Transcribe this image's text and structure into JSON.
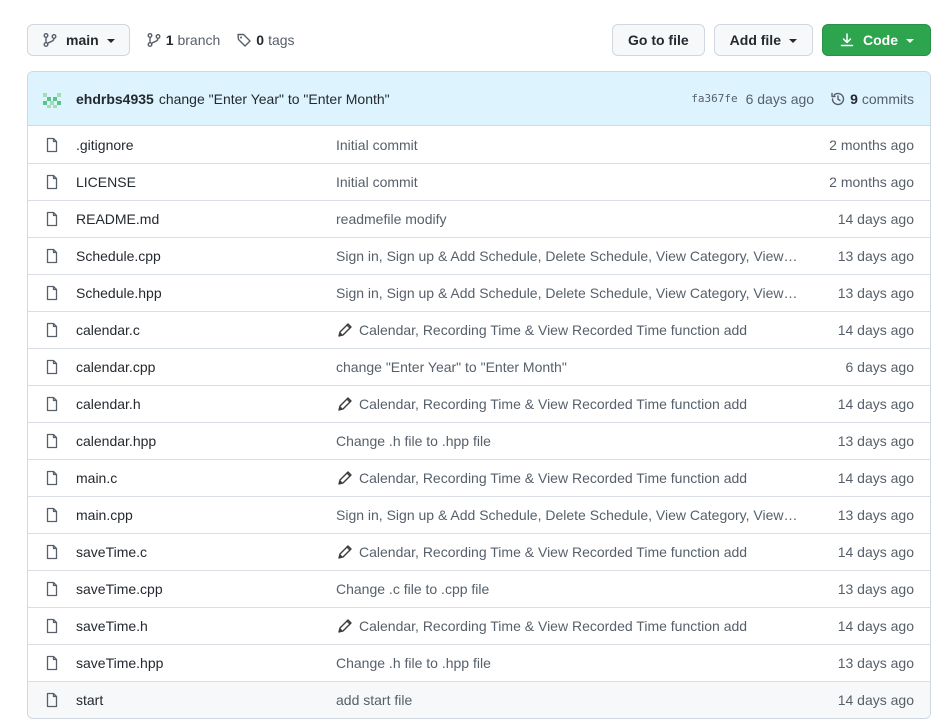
{
  "toolbar": {
    "branch_name": "main",
    "branches_count": "1",
    "branches_label": "branch",
    "tags_count": "0",
    "tags_label": "tags",
    "go_to_file": "Go to file",
    "add_file": "Add file",
    "code": "Code"
  },
  "commit": {
    "author": "ehdrbs4935",
    "message": "change \"Enter Year\" to \"Enter Month\"",
    "sha": "fa367fe",
    "age": "6 days ago",
    "commits_count": "9",
    "commits_label": "commits"
  },
  "files": [
    {
      "name": ".gitignore",
      "message": "Initial commit",
      "age": "2 months ago",
      "emoji": false
    },
    {
      "name": "LICENSE",
      "message": "Initial commit",
      "age": "2 months ago",
      "emoji": false
    },
    {
      "name": "README.md",
      "message": "readmefile modify",
      "age": "14 days ago",
      "emoji": false
    },
    {
      "name": "Schedule.cpp",
      "message": "Sign in, Sign up & Add Schedule, Delete Schedule, View Category, View…",
      "age": "13 days ago",
      "emoji": false
    },
    {
      "name": "Schedule.hpp",
      "message": "Sign in, Sign up & Add Schedule, Delete Schedule, View Category, View…",
      "age": "13 days ago",
      "emoji": false
    },
    {
      "name": "calendar.c",
      "message": "Calendar, Recording Time & View Recorded Time function add",
      "age": "14 days ago",
      "emoji": true
    },
    {
      "name": "calendar.cpp",
      "message": "change \"Enter Year\" to \"Enter Month\"",
      "age": "6 days ago",
      "emoji": false
    },
    {
      "name": "calendar.h",
      "message": "Calendar, Recording Time & View Recorded Time function add",
      "age": "14 days ago",
      "emoji": true
    },
    {
      "name": "calendar.hpp",
      "message": "Change .h file to .hpp file",
      "age": "13 days ago",
      "emoji": false
    },
    {
      "name": "main.c",
      "message": "Calendar, Recording Time & View Recorded Time function add",
      "age": "14 days ago",
      "emoji": true
    },
    {
      "name": "main.cpp",
      "message": "Sign in, Sign up & Add Schedule, Delete Schedule, View Category, View…",
      "age": "13 days ago",
      "emoji": false
    },
    {
      "name": "saveTime.c",
      "message": "Calendar, Recording Time & View Recorded Time function add",
      "age": "14 days ago",
      "emoji": true
    },
    {
      "name": "saveTime.cpp",
      "message": "Change .c file to .cpp file",
      "age": "13 days ago",
      "emoji": false
    },
    {
      "name": "saveTime.h",
      "message": "Calendar, Recording Time & View Recorded Time function add",
      "age": "14 days ago",
      "emoji": true
    },
    {
      "name": "saveTime.hpp",
      "message": "Change .h file to .hpp file",
      "age": "13 days ago",
      "emoji": false
    },
    {
      "name": "start",
      "message": "add start file",
      "age": "14 days ago",
      "emoji": false,
      "highlighted": true
    }
  ],
  "icons": {
    "branch": "git-branch-icon",
    "tag": "tag-icon",
    "download": "download-icon",
    "history": "history-icon",
    "file": "file-icon",
    "commit_emoji": "pencil-icon"
  },
  "colors": {
    "code_button": "#2da44e",
    "commit_bar": "#ddf4ff",
    "muted_text": "#57606a"
  }
}
